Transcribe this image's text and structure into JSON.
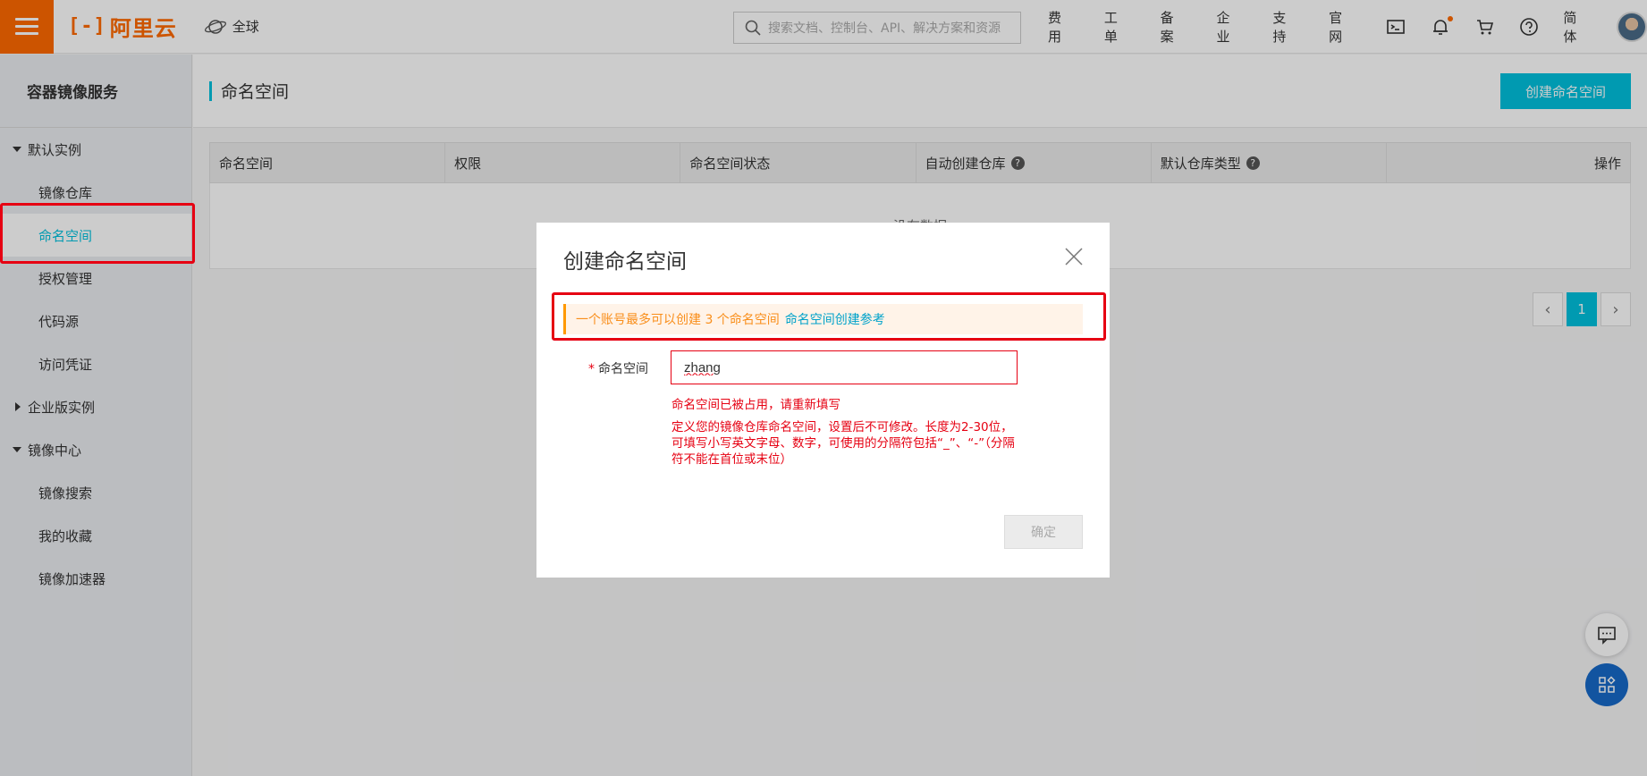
{
  "topbar": {
    "logo_text": "阿里云",
    "region": "全球",
    "search_placeholder": "搜索文档、控制台、API、解决方案和资源",
    "nav": [
      "费用",
      "工单",
      "备案",
      "企业",
      "支持",
      "官网"
    ],
    "lang": "简体",
    "colors": {
      "brand": "#ff6a00"
    }
  },
  "sidebar": {
    "title": "容器镜像服务",
    "groups": [
      {
        "label": "默认实例",
        "expanded": true,
        "items": [
          "镜像仓库",
          "命名空间",
          "授权管理",
          "代码源",
          "访问凭证"
        ]
      },
      {
        "label": "企业版实例",
        "expanded": false,
        "items": []
      },
      {
        "label": "镜像中心",
        "expanded": true,
        "items": [
          "镜像搜索",
          "我的收藏",
          "镜像加速器"
        ]
      }
    ],
    "active_item": "命名空间"
  },
  "main": {
    "title": "命名空间",
    "create_button": "创建命名空间",
    "columns": [
      "命名空间",
      "权限",
      "命名空间状态",
      "自动创建仓库",
      "默认仓库类型",
      "操作"
    ],
    "empty_text": "没有数据",
    "pager": {
      "current": "1"
    },
    "colors": {
      "accent": "#00c1de"
    }
  },
  "modal": {
    "title": "创建命名空间",
    "notice": "一个账号最多可以创建 3 个命名空间",
    "notice_link": "命名空间创建参考",
    "field_label": "命名空间",
    "field_value": "zhang",
    "error": "命名空间已被占用，请重新填写",
    "help": "定义您的镜像仓库命名空间，设置后不可修改。长度为2-30位，可填写小写英文字母、数字，可使用的分隔符包括“_”、“-”（分隔符不能在首位或末位）",
    "ok_button": "确定",
    "colors": {
      "error": "#e60012",
      "warning": "#f98e1a"
    }
  }
}
